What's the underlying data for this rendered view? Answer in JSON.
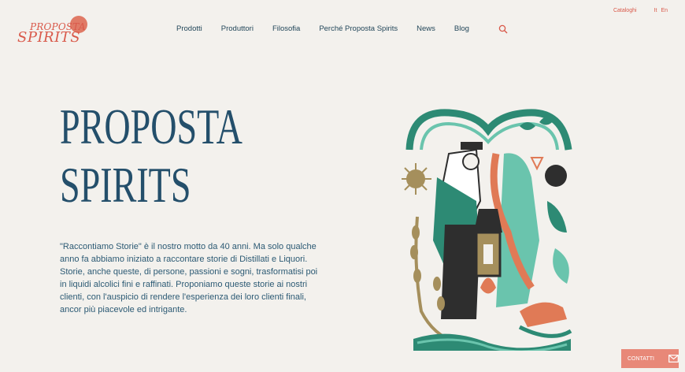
{
  "brand": {
    "logo_top": "PROPOSTA",
    "logo_bottom": "SPIRITS"
  },
  "topbar": {
    "catalog": "Cataloghi",
    "lang_it": "It",
    "lang_en": "En"
  },
  "nav": [
    "Prodotti",
    "Produttori",
    "Filosofia",
    "Perché Proposta Spirits",
    "News",
    "Blog"
  ],
  "hero": {
    "title_line1": "PROPOSTA",
    "title_line2": "SPIRITS",
    "description": "\"Raccontiamo Storie\" è il nostro motto da 40 anni. Ma solo qualche anno fa abbiamo iniziato a raccontare storie di Distillati e Liquori. Storie, anche queste, di persone, passioni e sogni, trasformatisi poi in liquidi alcolici fini e raffinati. Proponiamo queste storie ai nostri clienti, con l'auspicio di rendere l'esperienza dei loro clienti finali, ancor più piacevole ed intrigante."
  },
  "contact_label": "CONTATTI",
  "colors": {
    "accent": "#d9594a",
    "navy": "#244f6b",
    "teal": "#2d8a74",
    "mint": "#6ac4ad",
    "gold": "#a58f5c",
    "background": "#f3f1ed"
  },
  "icons": [
    "search-icon",
    "mail-icon"
  ]
}
